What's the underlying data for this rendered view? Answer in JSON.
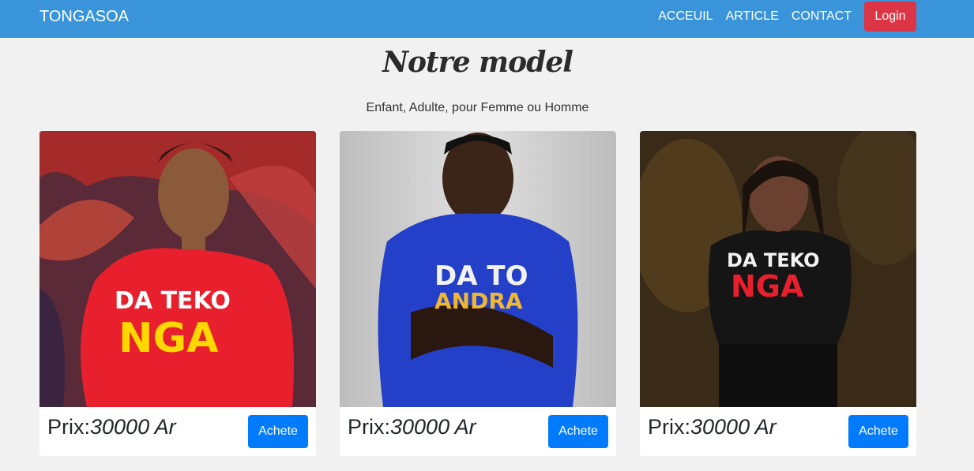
{
  "navbar": {
    "brand": "TONGASOA",
    "links": [
      "ACCEUIL",
      "ARTICLE",
      "CONTACT"
    ],
    "login_label": "Login"
  },
  "hero": {
    "title": "Notre model",
    "subtitle": "Enfant, Adulte, pour Femme ou Homme"
  },
  "products": [
    {
      "price_label": "Prix:",
      "price": "30000 Ar",
      "buy_label": "Achete",
      "shirt_text": [
        "DA TEKO",
        "NGA"
      ],
      "shirt_color": "#e8202e"
    },
    {
      "price_label": "Prix:",
      "price": "30000 Ar",
      "buy_label": "Achete",
      "shirt_text": [
        "DA TO",
        "ANDRA"
      ],
      "shirt_color": "#2440c8"
    },
    {
      "price_label": "Prix:",
      "price": "30000 Ar",
      "buy_label": "Achete",
      "shirt_text": [
        "DA TEKO",
        "NGA"
      ],
      "shirt_color": "#151515"
    }
  ],
  "colors": {
    "navbar": "#3a94d9",
    "login": "#dc3545",
    "buy": "#007bff"
  }
}
